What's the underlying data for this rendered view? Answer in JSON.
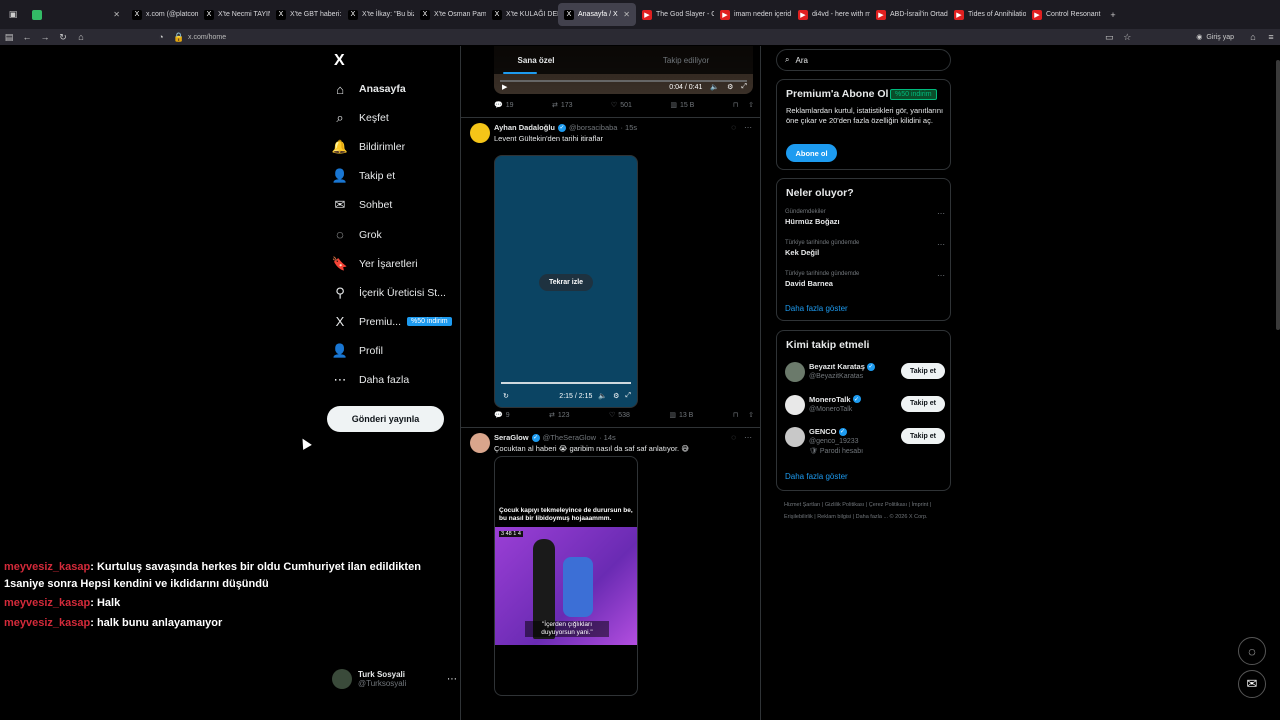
{
  "browser": {
    "tabs": [
      {
        "label": "",
        "active": false,
        "fav": "#3b6",
        "glyph": ""
      },
      {
        "label": "x.com (@platcom)",
        "active": false,
        "fav": "#000",
        "glyph": "X"
      },
      {
        "label": "X'te Necmi TAYIN: \"",
        "active": false,
        "fav": "#000",
        "glyph": "X"
      },
      {
        "label": "X'te GBT haberi: \"E",
        "active": false,
        "fav": "#000",
        "glyph": "X"
      },
      {
        "label": "X'te İlkay: \"Bu bizim",
        "active": false,
        "fav": "#000",
        "glyph": "X"
      },
      {
        "label": "X'te Osman Pamuk:",
        "active": false,
        "fav": "#000",
        "glyph": "X"
      },
      {
        "label": "X'te KULAĞI DELİK",
        "active": false,
        "fav": "#000",
        "glyph": "X"
      },
      {
        "label": "Anasayfa / X",
        "active": true,
        "fav": "#000",
        "glyph": "X"
      },
      {
        "label": "The God Slayer - G",
        "active": false,
        "fav": "#e02020",
        "glyph": "▶"
      },
      {
        "label": "imam neden içerid",
        "active": false,
        "fav": "#e02020",
        "glyph": "▶"
      },
      {
        "label": "di4vd - here with m",
        "active": false,
        "fav": "#e02020",
        "glyph": "▶"
      },
      {
        "label": "ABD-İsrail'in Ortad",
        "active": false,
        "fav": "#e02020",
        "glyph": "▶"
      },
      {
        "label": "Tides of Annihilatio",
        "active": false,
        "fav": "#e02020",
        "glyph": "▶"
      },
      {
        "label": "Control Resonant",
        "active": false,
        "fav": "#e02020",
        "glyph": "▶"
      }
    ],
    "url": "x.com/home",
    "sign_in": "Giriş yap"
  },
  "sidebar": {
    "logo": "X",
    "items": [
      {
        "label": "Anasayfa",
        "icon": "⌂",
        "bold": true
      },
      {
        "label": "Keşfet",
        "icon": "⌕",
        "bold": false
      },
      {
        "label": "Bildirimler",
        "icon": "🔔",
        "bold": false
      },
      {
        "label": "Takip et",
        "icon": "👤",
        "bold": false
      },
      {
        "label": "Sohbet",
        "icon": "✉",
        "bold": false
      },
      {
        "label": "Grok",
        "icon": "◌",
        "bold": false
      },
      {
        "label": "Yer İşaretleri",
        "icon": "🔖",
        "bold": false
      },
      {
        "label": "İçerik Üreticisi St...",
        "icon": "⚲",
        "bold": false
      },
      {
        "label": "Premiu...",
        "icon": "X",
        "bold": false
      },
      {
        "label": "Profil",
        "icon": "👤",
        "bold": false
      },
      {
        "label": "Daha fazla",
        "icon": "⋯",
        "bold": false
      }
    ],
    "premium_badge": "%50 indirim",
    "post_button": "Gönderi yayınla",
    "account": {
      "name": "Turk Sosyali",
      "handle": "@Turksosyali"
    }
  },
  "chat": [
    {
      "user": "meyvesiz_kasap",
      "text": ": Kurtuluş savaşında herkes bir oldu Cumhuriyet ilan edildikten 1saniye sonra Hepsi kendini ve ikdidarını düşündü"
    },
    {
      "user": "meyvesiz_kasap",
      "text": ": Halk"
    },
    {
      "user": "meyvesiz_kasap",
      "text": ": halk bunu anlayamaıyor"
    }
  ],
  "timeline": {
    "tabs": [
      "Sana özel",
      "Takip ediliyor"
    ],
    "top_video": {
      "time": "0:04 / 0:41"
    },
    "top_actions": {
      "replies": "19",
      "reposts": "173",
      "likes": "501",
      "views": "15 B"
    },
    "tweet1": {
      "name": "Ayhan Dadaloğlu",
      "handle": "@borsacibaba",
      "time": "· 15s",
      "text": "Levent Gültekin'den tarihi itiraflar",
      "replay": "Tekrar izle",
      "video_time": "2:15 / 2:15",
      "replies": "9",
      "reposts": "123",
      "likes": "538",
      "views": "13 B"
    },
    "tweet2": {
      "name": "SeraGlow",
      "handle": "@TheSeraGlow",
      "time": "· 14s",
      "text": "Çocuktan al haberi 😭 garibim nasıl da saf saf anlatıyor. 😅",
      "caption": "Çocuk kapıyı tekmeleyince de durursun be, bu nasıl bir libidoymuş hojaaammm.",
      "subtitle": "\"İçerden çığlıkları duyuyorsun yani.\"",
      "stamp": "3 48 1 4"
    }
  },
  "right": {
    "search_placeholder": "Ara",
    "premium": {
      "title": "Premium'a Abone Ol",
      "badge": "%50 indirim",
      "text": "Reklamlardan kurtul, istatistikleri gör, yanıtlarını öne çıkar ve 20'den fazla özelliğin kilidini aç.",
      "button": "Abone ol"
    },
    "trends": {
      "title": "Neler oluyor?",
      "items": [
        {
          "context": "Gündemdekiler",
          "name": "Hürmüz Boğazı"
        },
        {
          "context": "Türkiye tarihinde gündemde",
          "name": "Kek Değil"
        },
        {
          "context": "Türkiye tarihinde gündemde",
          "name": "David Barnea"
        }
      ],
      "show_more": "Daha fazla göster"
    },
    "who_to_follow": {
      "title": "Kimi takip etmeli",
      "items": [
        {
          "name": "Beyazıt Karataş",
          "handle": "@BeyazitKaratas",
          "extra": ""
        },
        {
          "name": "MoneroTalk",
          "handle": "@MoneroTalk",
          "extra": ""
        },
        {
          "name": "GENCO",
          "handle": "@genco_19233",
          "extra": "🛡 Parodi hesabı"
        }
      ],
      "follow_label": "Takip et",
      "show_more": "Daha fazla göster"
    },
    "footer": "Hizmet Şartları | Gizlilik Politikası | Çerez Politikası | İmprint | Erişilebilirlik | Reklam bilgisi | Daha fazla ... © 2026 X Corp."
  }
}
